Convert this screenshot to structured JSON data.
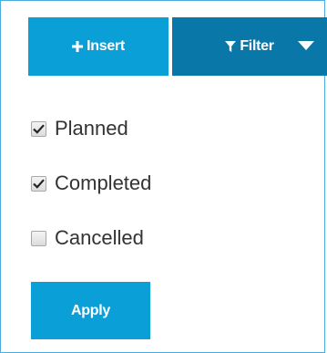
{
  "toolbar": {
    "insert_label": "Insert",
    "filter_label": "Filter"
  },
  "filter_options": [
    {
      "label": "Planned",
      "checked": true
    },
    {
      "label": "Completed",
      "checked": true
    },
    {
      "label": "Cancelled",
      "checked": false
    }
  ],
  "apply_label": "Apply",
  "colors": {
    "accent": "#0b9fd8",
    "accent_dark": "#0a77a9",
    "border": "#4aaee0",
    "text": "#333333"
  },
  "icons": {
    "insert": "plus-icon",
    "filter": "funnel-icon",
    "dropdown": "caret-down-icon",
    "check": "check-icon"
  }
}
